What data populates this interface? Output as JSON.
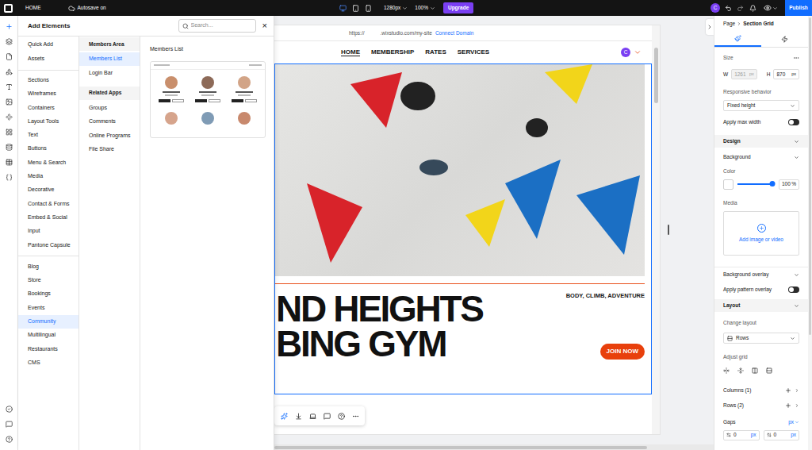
{
  "topbar": {
    "page": "HOME",
    "autosave": "Autosave on",
    "devices": [
      {
        "selected": true
      },
      {
        "selected": false
      },
      {
        "selected": false
      }
    ],
    "width": "1280px",
    "zoom": "100%",
    "upgrade": "Upgrade",
    "avatar": "C",
    "publish": "Publish"
  },
  "rail": {
    "top": [
      {
        "selected": true
      },
      {
        "selected": false
      },
      {
        "selected": false
      },
      {
        "selected": false
      },
      {
        "selected": false
      },
      {
        "selected": false
      },
      {
        "selected": false
      },
      {
        "selected": false
      },
      {
        "selected": false
      },
      {
        "selected": false
      },
      {
        "selected": false
      }
    ],
    "bottom": [
      {
        "selected": false
      },
      {
        "selected": false
      },
      {
        "selected": false
      }
    ]
  },
  "add_panel": {
    "title": "Add Elements",
    "search_placeholder": "Search...",
    "close": "×",
    "categories": [
      {
        "items": [
          {
            "label": "Quick Add",
            "selected": false
          },
          {
            "label": "Assets",
            "selected": false
          }
        ]
      },
      {
        "items": [
          {
            "label": "Sections",
            "selected": false
          },
          {
            "label": "Wireframes",
            "selected": false
          },
          {
            "label": "Containers",
            "selected": false
          },
          {
            "label": "Layout Tools",
            "selected": false
          },
          {
            "label": "Text",
            "selected": false
          },
          {
            "label": "Buttons",
            "selected": false
          },
          {
            "label": "Menu & Search",
            "selected": false
          },
          {
            "label": "Media",
            "selected": false
          },
          {
            "label": "Decorative",
            "selected": false
          },
          {
            "label": "Contact & Forms",
            "selected": false
          },
          {
            "label": "Embed & Social",
            "selected": false
          },
          {
            "label": "Input",
            "selected": false
          },
          {
            "label": "Pantone Capsule",
            "selected": false
          }
        ]
      },
      {
        "items": [
          {
            "label": "Blog",
            "selected": false
          },
          {
            "label": "Store",
            "selected": false
          },
          {
            "label": "Bookings",
            "selected": false
          },
          {
            "label": "Events",
            "selected": false
          },
          {
            "label": "Community",
            "selected": true
          },
          {
            "label": "Multilingual",
            "selected": false
          },
          {
            "label": "Restaurants",
            "selected": false
          },
          {
            "label": "CMS",
            "selected": false
          }
        ]
      }
    ],
    "subcategories": [
      {
        "heading": "Members Area",
        "items": [
          {
            "label": "Members List",
            "selected": true
          },
          {
            "label": "Login Bar",
            "selected": false
          }
        ]
      },
      {
        "heading": "Related Apps",
        "items": [
          {
            "label": "Groups",
            "selected": false
          },
          {
            "label": "Comments",
            "selected": false
          },
          {
            "label": "Online Programs",
            "selected": false
          },
          {
            "label": "File Share",
            "selected": false
          }
        ]
      }
    ],
    "preview_title": "Members List"
  },
  "site": {
    "url_prefix": "https://",
    "url": ".wixstudio.com/my-site",
    "connect": "Connect Domain",
    "nav": [
      {
        "label": "HOME",
        "selected": true
      },
      {
        "label": "MEMBERSHIP",
        "selected": false
      },
      {
        "label": "RATES",
        "selected": false
      },
      {
        "label": "SERVICES",
        "selected": false
      }
    ],
    "avatar": "C",
    "headline": [
      "ND HEIGHTS",
      "BING GYM"
    ],
    "tagline": "BODY, CLIMB, ADVENTURE",
    "cta": "JOIN NOW"
  },
  "inspector": {
    "breadcrumb": [
      "Page",
      "Section Grid"
    ],
    "tabs": [
      {
        "selected": true
      },
      {
        "selected": false
      }
    ],
    "size": {
      "label": "Size",
      "w_label": "W",
      "w": "1261",
      "w_unit": "px",
      "w_disabled": true,
      "h_label": "H",
      "h": "870",
      "h_unit": "px"
    },
    "responsive": {
      "label": "Responsive behavior",
      "value": "Fixed height"
    },
    "max_width": {
      "label": "Apply max width",
      "on": false
    },
    "design": {
      "title": "Design",
      "background": "Background",
      "color_label": "Color",
      "color": "#ffffff",
      "opacity": {
        "level": 1,
        "reading": "100",
        "unit": "%"
      },
      "media_label": "Media",
      "media_action": "Add image or video",
      "overlay": "Background overlay",
      "pattern": {
        "label": "Apply pattern overlay",
        "on": false
      }
    },
    "layout": {
      "title": "Layout",
      "change_label": "Change layout",
      "value": "Rows",
      "adjust": "Adjust grid",
      "columns": "Columns (1)",
      "rows": "Rows (2)",
      "gaps": "Gaps",
      "gaps_unit": "px",
      "gap_h": "0",
      "gap_v": "0",
      "gap_unit": "px"
    }
  }
}
